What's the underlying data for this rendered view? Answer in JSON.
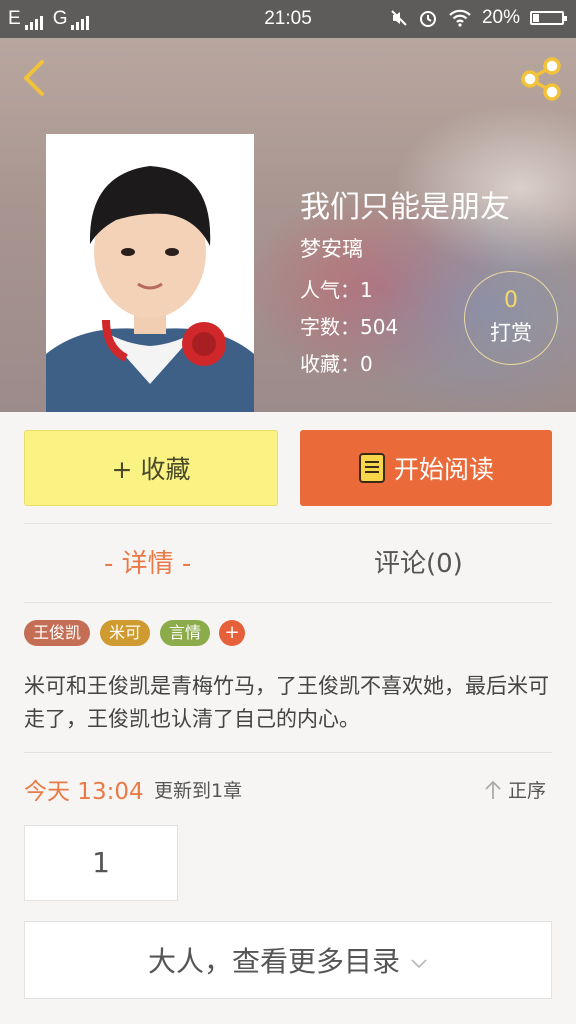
{
  "status_bar": {
    "carrier1": "E",
    "carrier2": "G",
    "time": "21:05",
    "battery": "20%",
    "battery_level": 0.2
  },
  "book": {
    "title": "我们只能是朋友",
    "author": "梦安璃",
    "popularity": "人气：1",
    "words": "字数：504",
    "favorites": "收藏：0",
    "tip_count": "0",
    "tip_label": "打赏"
  },
  "actions": {
    "collect_label": "+ 收藏",
    "read_label": "开始阅读"
  },
  "tabs": [
    {
      "label": "- 详情 -",
      "active": true
    },
    {
      "label": "评论(0)",
      "active": false
    }
  ],
  "tags": [
    "王俊凯",
    "米可",
    "言情"
  ],
  "tag_add": "+",
  "description": "米可和王俊凯是青梅竹马，了王俊凯不喜欢她，最后米可走了，王俊凯也认清了自己的内心。",
  "update": {
    "time": "今天 13:04",
    "text": "更新到1章",
    "sort_label": "正序"
  },
  "chapter_number": "1",
  "more_catalog": "大人，查看更多目录",
  "colors": {
    "accent": "#ea6a3a",
    "collect_bg": "#fbf284",
    "tab_active": "#ea7a45"
  },
  "icons": [
    "back-icon",
    "share-icon",
    "book-icon",
    "sort-up-icon",
    "chevron-down-icon"
  ]
}
